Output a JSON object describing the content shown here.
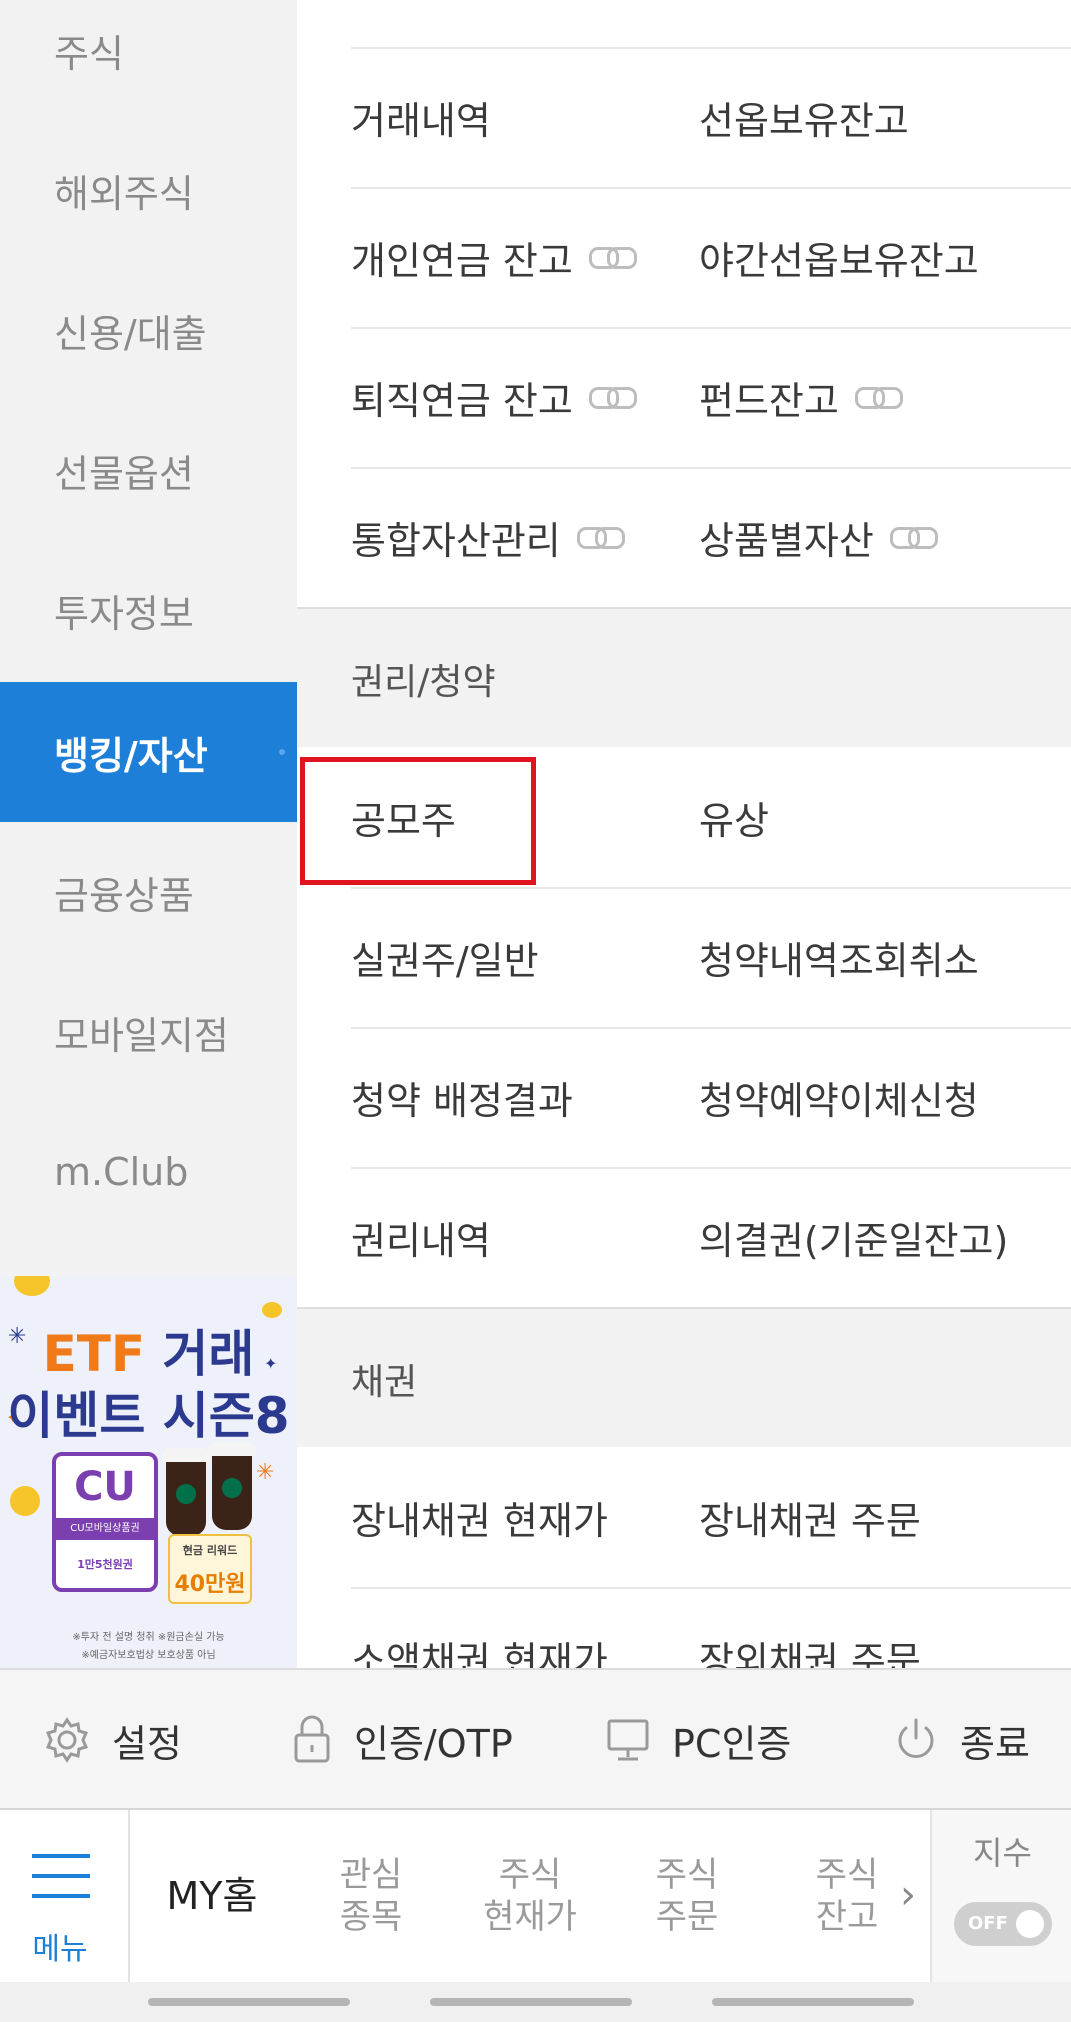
{
  "sidebar": {
    "items": [
      {
        "label": "주식",
        "active": false
      },
      {
        "label": "해외주식",
        "active": false
      },
      {
        "label": "신용/대출",
        "active": false
      },
      {
        "label": "선물옵션",
        "active": false
      },
      {
        "label": "투자정보",
        "active": false
      },
      {
        "label": "뱅킹/자산",
        "active": true
      },
      {
        "label": "금융상품",
        "active": false
      },
      {
        "label": "모바일지점",
        "active": false
      },
      {
        "label": "m.Club",
        "active": false
      }
    ],
    "active_color": "#1e7fd8"
  },
  "banner": {
    "line1_a": "ETF",
    "line1_b": "거래",
    "line2": "이벤트 시즌8",
    "card_brand": "CU",
    "card_sub": "CU모바일상품권",
    "card_amount": "1만5천원권",
    "reward_label": "현금 리워드",
    "reward_amount": "40만원",
    "note1": "※투자 전 설명 청취 ※원금손실 가능",
    "note2": "※예금자보호법상 보호상품 아님"
  },
  "content": {
    "rows_top": [
      {
        "left": {
          "label": "거래내역",
          "link": false
        },
        "right": {
          "label": "선옵보유잔고",
          "link": false
        }
      },
      {
        "left": {
          "label": "개인연금 잔고",
          "link": true
        },
        "right": {
          "label": "야간선옵보유잔고",
          "link": false
        }
      },
      {
        "left": {
          "label": "퇴직연금 잔고",
          "link": true
        },
        "right": {
          "label": "펀드잔고",
          "link": true
        }
      },
      {
        "left": {
          "label": "통합자산관리",
          "link": true
        },
        "right": {
          "label": "상품별자산",
          "link": true
        }
      }
    ],
    "section_rights": {
      "title": "권리/청약",
      "rows": [
        {
          "left": "공모주",
          "right": "유상"
        },
        {
          "left": "실권주/일반",
          "right": "청약내역조회취소"
        },
        {
          "left": "청약 배정결과",
          "right": "청약예약이체신청"
        },
        {
          "left": "권리내역",
          "right": "의결권(기준일잔고)"
        }
      ]
    },
    "section_bonds": {
      "title": "채권",
      "rows": [
        {
          "left": "장내채권 현재가",
          "right": "장내채권 주문"
        },
        {
          "left": "소액채권 현재가",
          "right": "장외채권 주문"
        }
      ]
    },
    "highlight_color": "#e0141e"
  },
  "utility_bar": {
    "settings": "설정",
    "otp": "인증/OTP",
    "pc_auth": "PC인증",
    "exit": "종료"
  },
  "tab_bar": {
    "menu": "메뉴",
    "home": "MY홈",
    "tabs": [
      {
        "line1": "관심",
        "line2": "종목"
      },
      {
        "line1": "주식",
        "line2": "현재가"
      },
      {
        "line1": "주식",
        "line2": "주문"
      },
      {
        "line1": "주식",
        "line2": "잔고"
      }
    ],
    "more_arrow": "›",
    "index_label": "지수",
    "index_toggle": "OFF"
  }
}
